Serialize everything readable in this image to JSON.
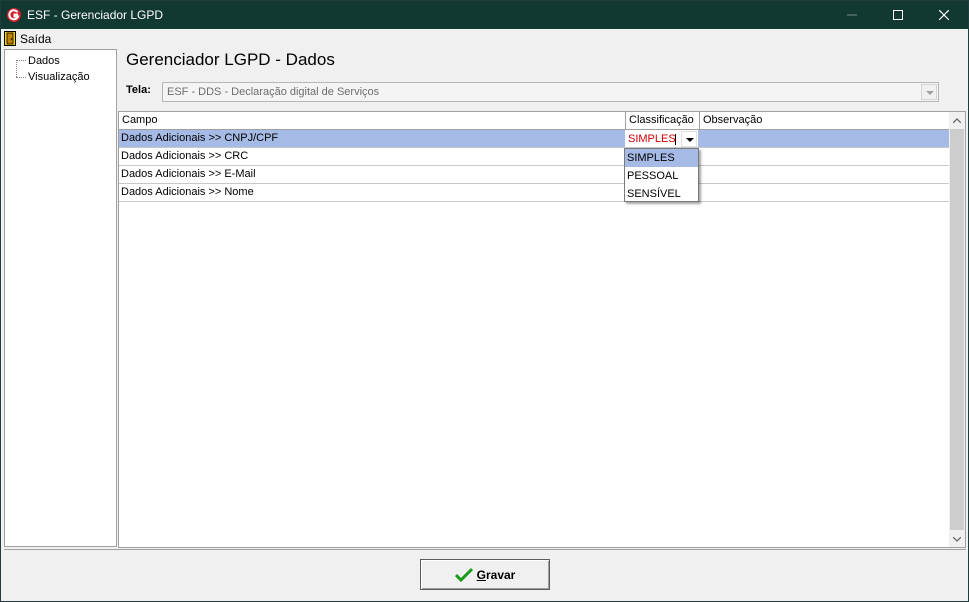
{
  "window": {
    "title": "ESF - Gerenciador LGPD"
  },
  "menu": {
    "exit_label": "Saída"
  },
  "tree": {
    "items": [
      "Dados",
      "Visualização"
    ]
  },
  "main": {
    "title": "Gerenciador LGPD - Dados",
    "tela_label": "Tela:",
    "tela_value": "ESF - DDS - Declaração digital de Serviços"
  },
  "grid": {
    "columns": [
      "Campo",
      "Classificação",
      "Observação"
    ],
    "rows": [
      {
        "campo": "Dados Adicionais >> CNPJ/CPF",
        "classificacao": "SIMPLES",
        "observacao": ""
      },
      {
        "campo": "Dados Adicionais >> CRC",
        "classificacao": "",
        "observacao": ""
      },
      {
        "campo": "Dados Adicionais >> E-Mail",
        "classificacao": "",
        "observacao": ""
      },
      {
        "campo": "Dados Adicionais >> Nome",
        "classificacao": "",
        "observacao": ""
      }
    ],
    "selected_row": 0,
    "editor_value": "SIMPLES",
    "dropdown_options": [
      "SIMPLES",
      "PESSOAL",
      "SENSÍVEL"
    ],
    "dropdown_highlighted": "SIMPLES"
  },
  "footer": {
    "save_label": "Gravar"
  },
  "colors": {
    "titlebar": "#113831",
    "selection": "#a6bae6",
    "editor_text": "#cc0000"
  }
}
